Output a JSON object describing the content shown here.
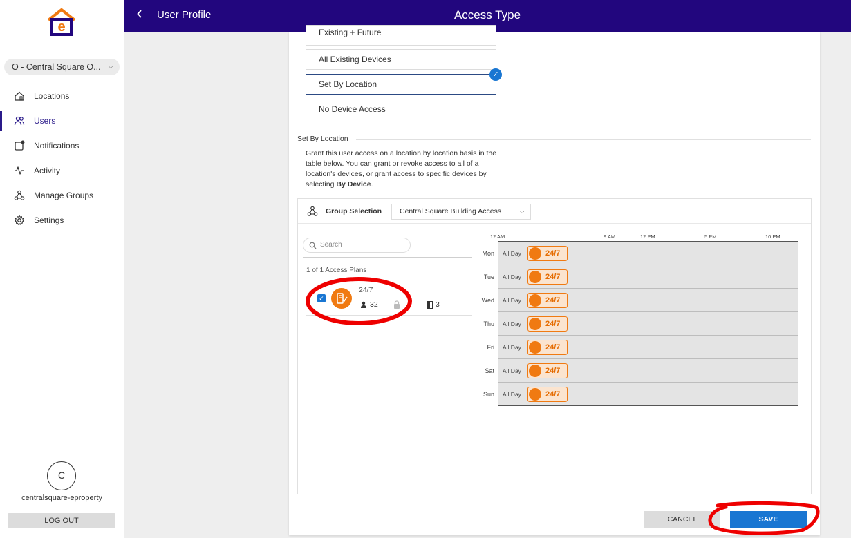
{
  "sidebar": {
    "org_name": "O - Central Square O...",
    "items": [
      {
        "label": "Locations",
        "icon": "home-icon"
      },
      {
        "label": "Users",
        "icon": "users-icon"
      },
      {
        "label": "Notifications",
        "icon": "notification-icon"
      },
      {
        "label": "Activity",
        "icon": "activity-icon"
      },
      {
        "label": "Manage Groups",
        "icon": "groups-icon"
      },
      {
        "label": "Settings",
        "icon": "gear-icon"
      }
    ],
    "avatar_initial": "C",
    "username": "centralsquare-eproperty",
    "logout_label": "LOG OUT"
  },
  "header": {
    "breadcrumb": "User Profile",
    "title": "Access Type"
  },
  "access_options": [
    {
      "label": "Existing + Future",
      "selected": false
    },
    {
      "label": "All Existing Devices",
      "selected": false
    },
    {
      "label": "Set By Location",
      "selected": true
    },
    {
      "label": "No Device Access",
      "selected": false
    }
  ],
  "section": {
    "title": "Set By Location",
    "description_main": "Grant this user access on a location by location basis in the table below. You can grant or revoke access to all of a location's devices, or grant access to specific devices by selecting ",
    "description_bold": "By Device",
    "description_end": "."
  },
  "group_selection": {
    "label": "Group Selection",
    "value": "Central Square Building Access"
  },
  "plans": {
    "search_placeholder": "Search",
    "count_text": "1 of 1 Access Plans",
    "items": [
      {
        "name": "24/7",
        "users": "32",
        "doors": "3",
        "checked": true
      }
    ]
  },
  "schedule": {
    "ticks": [
      "12 AM",
      "9 AM",
      "12 PM",
      "5 PM",
      "10 PM"
    ],
    "days": [
      "Mon",
      "Tue",
      "Wed",
      "Thu",
      "Fri",
      "Sat",
      "Sun"
    ],
    "all_day_label": "All Day",
    "plan_badge": "24/7"
  },
  "footer": {
    "cancel_label": "CANCEL",
    "save_label": "SAVE"
  },
  "colors": {
    "header_bg": "#22067e",
    "accent_blue": "#1976d2",
    "plan_orange": "#f07a12",
    "annotation_red": "#ee0000"
  }
}
